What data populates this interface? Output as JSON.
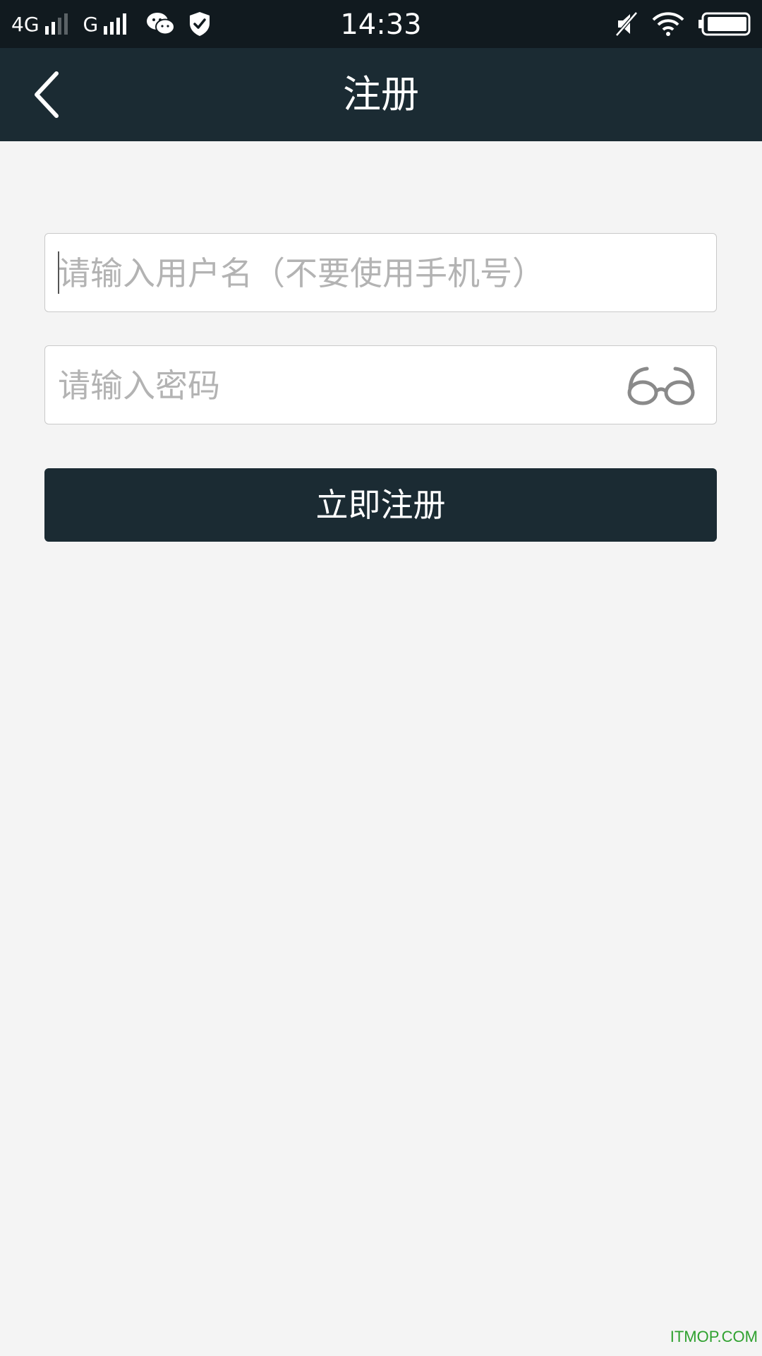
{
  "status_bar": {
    "network_1": "4G",
    "network_2": "G",
    "time": "14:33",
    "icons": [
      "signal-icon",
      "wechat-icon",
      "shield-icon",
      "mute-icon",
      "wifi-icon",
      "battery-icon"
    ]
  },
  "header": {
    "title": "注册",
    "back_icon": "chevron-left-icon"
  },
  "form": {
    "username_placeholder": "请输入用户名（不要使用手机号）",
    "username_value": "",
    "password_placeholder": "请输入密码",
    "password_value": "",
    "toggle_icon": "glasses-icon",
    "submit_label": "立即注册"
  },
  "watermark": "ITMOP.COM",
  "colors": {
    "header_bg": "#1b2b33",
    "status_bg": "#111a1f",
    "page_bg": "#f4f4f4",
    "button_bg": "#1b2b33",
    "watermark": "#2fa12f"
  }
}
